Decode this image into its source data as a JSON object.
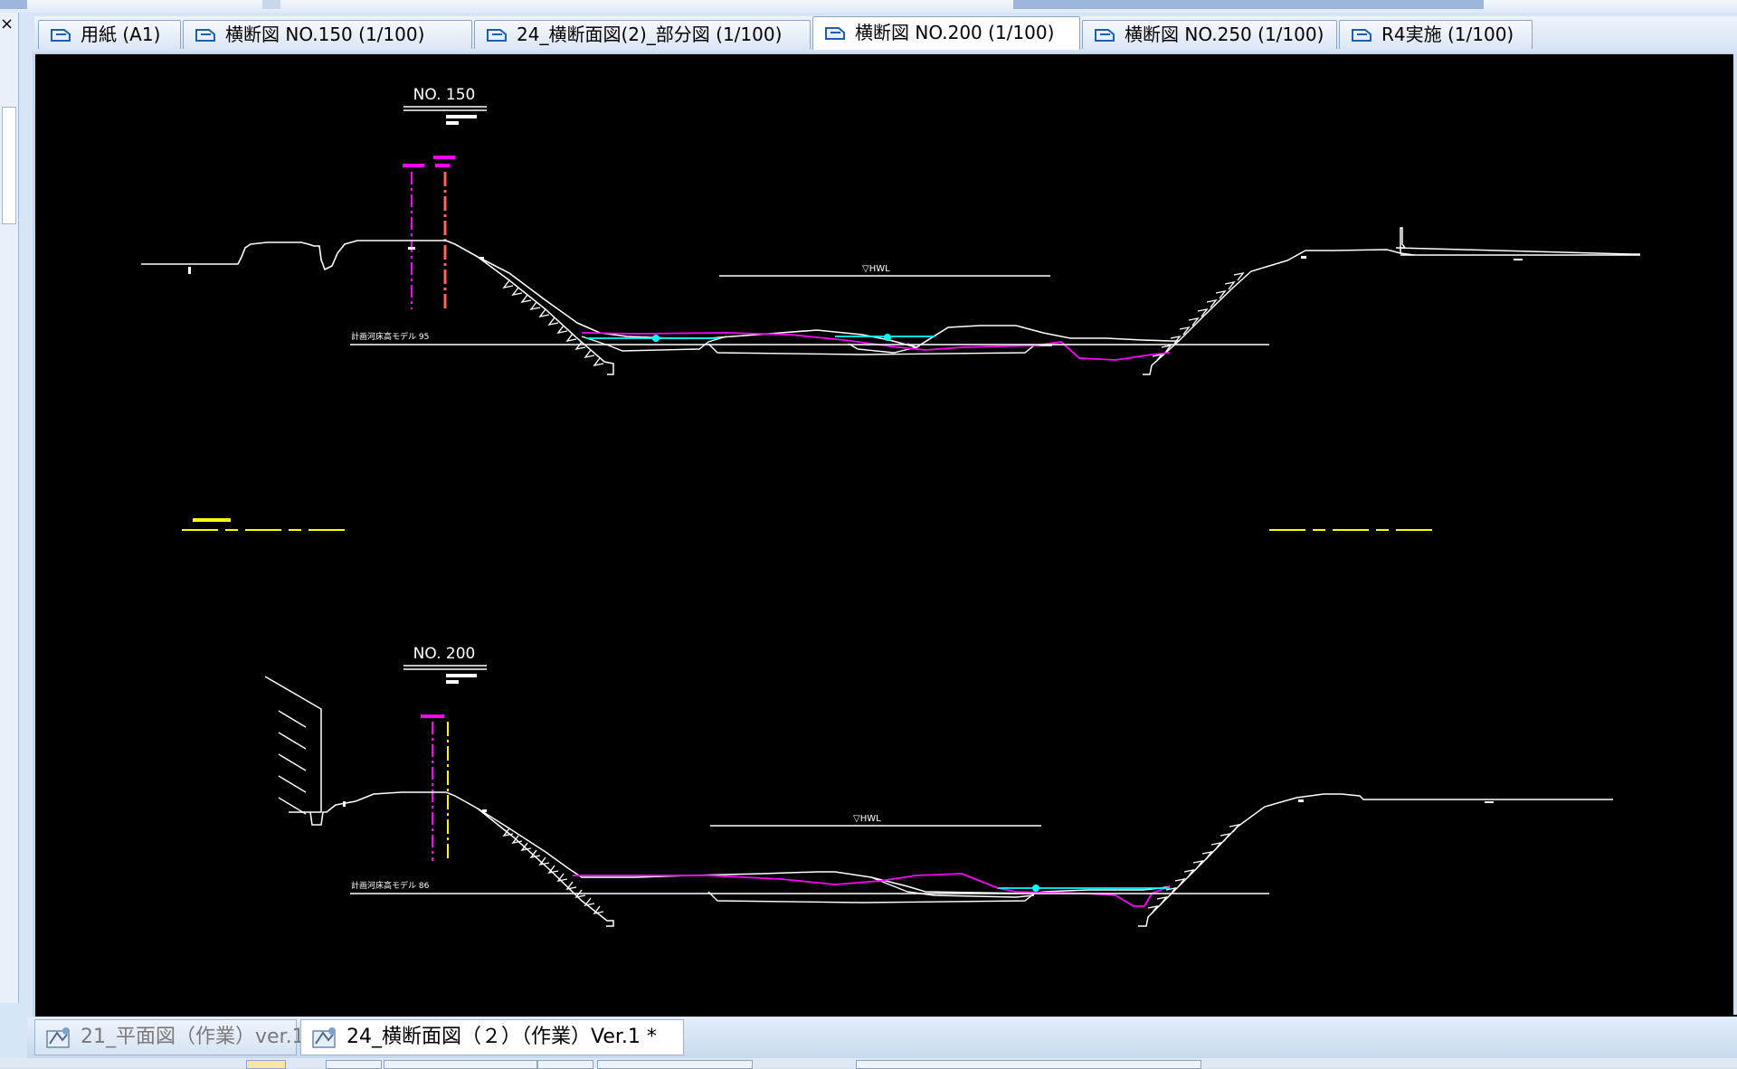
{
  "window": {
    "close_glyph": "×"
  },
  "layout_tabs": [
    {
      "label": "用紙 (A1)",
      "active": false
    },
    {
      "label": "横断図 NO.150 (1/100)",
      "active": false
    },
    {
      "label": "24_横断面図(2)_部分図 (1/100)",
      "active": false
    },
    {
      "label": "横断図 NO.200 (1/100)",
      "active": true
    },
    {
      "label": "横断図 NO.250 (1/100)",
      "active": false
    },
    {
      "label": "R4実施 (1/100)",
      "active": false
    }
  ],
  "drawing": {
    "background": "#000000",
    "colors": {
      "terrain": "#ffffff",
      "plan": "#ff00ff",
      "water": "#00ffff",
      "marker": "#ffff00",
      "center": "#ff6060"
    },
    "section_1": {
      "title": "NO. 150",
      "hwl_label": "▽HWL",
      "datum_text": "計画河床高モデル 95"
    },
    "section_2": {
      "title": "NO. 200",
      "hwl_label": "▽HWL",
      "datum_text": "計画河床高モデル 86"
    }
  },
  "doc_tabs": [
    {
      "label": "21_平面図（作業）ver.1",
      "active": false
    },
    {
      "label": "24_横断面図（２）（作業）Ver.1 *",
      "active": true
    }
  ]
}
